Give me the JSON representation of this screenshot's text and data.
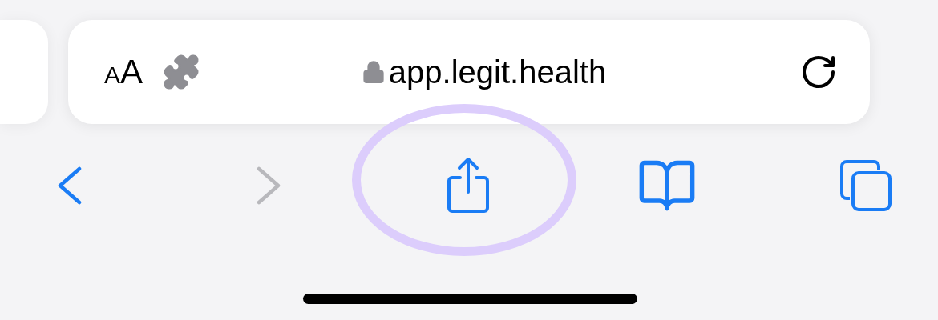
{
  "address_bar": {
    "text_size_glyphs": [
      "A",
      "A"
    ],
    "url": "app.legit.health",
    "secure": true
  },
  "toolbar": [
    {
      "kind": "back",
      "disabled": false,
      "highlighted": false
    },
    {
      "kind": "forward",
      "disabled": true,
      "highlighted": false
    },
    {
      "kind": "share",
      "disabled": false,
      "highlighted": true
    },
    {
      "kind": "bookmarks",
      "disabled": false,
      "highlighted": false
    },
    {
      "kind": "tabs",
      "disabled": false,
      "highlighted": false
    }
  ]
}
